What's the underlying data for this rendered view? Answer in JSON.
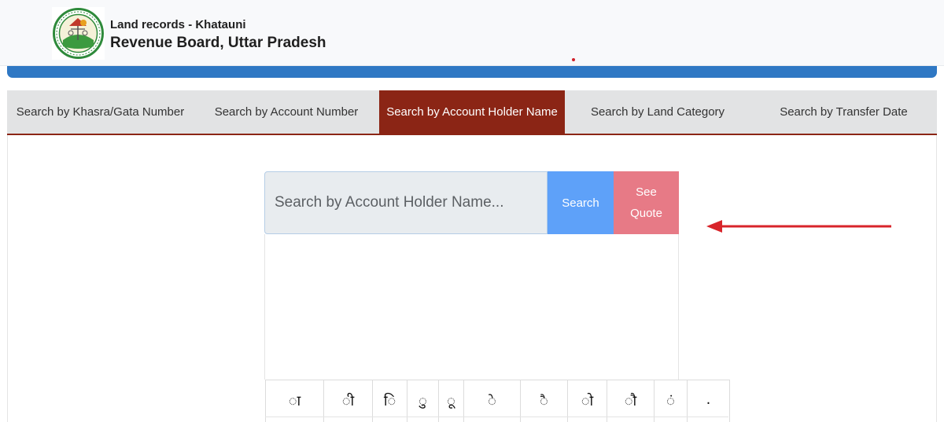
{
  "header": {
    "title_small": "Land records - Khatauni",
    "title_large": "Revenue Board, Uttar Pradesh",
    "logo_icon": "revenue-board-seal-logo"
  },
  "tabs": [
    {
      "label": "Search by Khasra/Gata Number",
      "active": false
    },
    {
      "label": "Search by Account Number",
      "active": false
    },
    {
      "label": "Search by Account Holder Name",
      "active": true
    },
    {
      "label": "Search by Land Category",
      "active": false
    },
    {
      "label": "Search by Transfer Date",
      "active": false
    }
  ],
  "search": {
    "placeholder": "Search by Account Holder Name...",
    "search_label": "Search",
    "quote_label_line1": "See",
    "quote_label_line2": "Quote"
  },
  "keyboard": {
    "keys": [
      "ा",
      "ी",
      "ि",
      "ु",
      "ू",
      "े",
      "ै",
      "ो",
      "ौ",
      "ं",
      "."
    ]
  },
  "colors": {
    "brand_blue": "#2f78c4",
    "tab_active": "#8b2515",
    "search_button": "#5ea1f9",
    "quote_button": "#e77a86",
    "arrow": "#d8242a"
  }
}
